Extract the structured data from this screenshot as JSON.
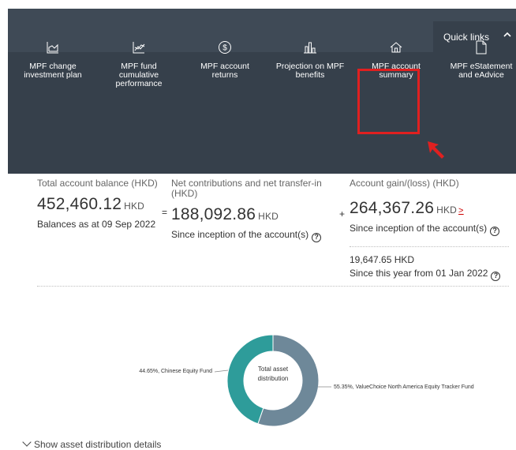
{
  "quick_links": {
    "toggle_label": "Quick links",
    "items": [
      {
        "label": "MPF change investment plan",
        "icon": "chart-area-icon"
      },
      {
        "label": "MPF fund cumulative performance",
        "icon": "line-chart-icon"
      },
      {
        "label": "MPF account returns",
        "icon": "dollar-circle-icon"
      },
      {
        "label": "Projection on MPF benefits",
        "icon": "bar-chart-icon"
      },
      {
        "label": "MPF account summary",
        "icon": "home-icon"
      },
      {
        "label": "MPF eStatement and eAdvice",
        "icon": "document-icon"
      }
    ]
  },
  "summary": {
    "total": {
      "label": "Total account balance (HKD)",
      "value": "452,460.12",
      "unit": "HKD",
      "note": "Balances as at 09 Sep 2022"
    },
    "net": {
      "sign": "=",
      "label": "Net contributions and net transfer-in (HKD)",
      "value": "188,092.86",
      "unit": "HKD",
      "note": "Since inception of the account(s)"
    },
    "gain": {
      "sign": "+",
      "label": "Account gain/(loss) (HKD)",
      "value": "264,367.26",
      "unit": "HKD",
      "link": ">",
      "note": "Since inception of the account(s)",
      "ytd_value": "19,647.65 HKD",
      "ytd_note": "Since this year from 01 Jan 2022"
    }
  },
  "distribution": {
    "center_label_1": "Total asset",
    "center_label_2": "distribution",
    "show_details": "Show asset distribution details",
    "colors": {
      "chinese": "#2e9c9a",
      "valuechoice": "#6e8899"
    }
  },
  "chart_data": {
    "type": "pie",
    "title": "Total asset distribution",
    "slices": [
      {
        "label": "ValueChoice North America Equity Tracker Fund",
        "value": 55.35,
        "display": "55.35%, ValueChoice North America Equity Tracker Fund"
      },
      {
        "label": "Chinese Equity Fund",
        "value": 44.65,
        "display": "44.65%, Chinese Equity Fund"
      }
    ]
  }
}
